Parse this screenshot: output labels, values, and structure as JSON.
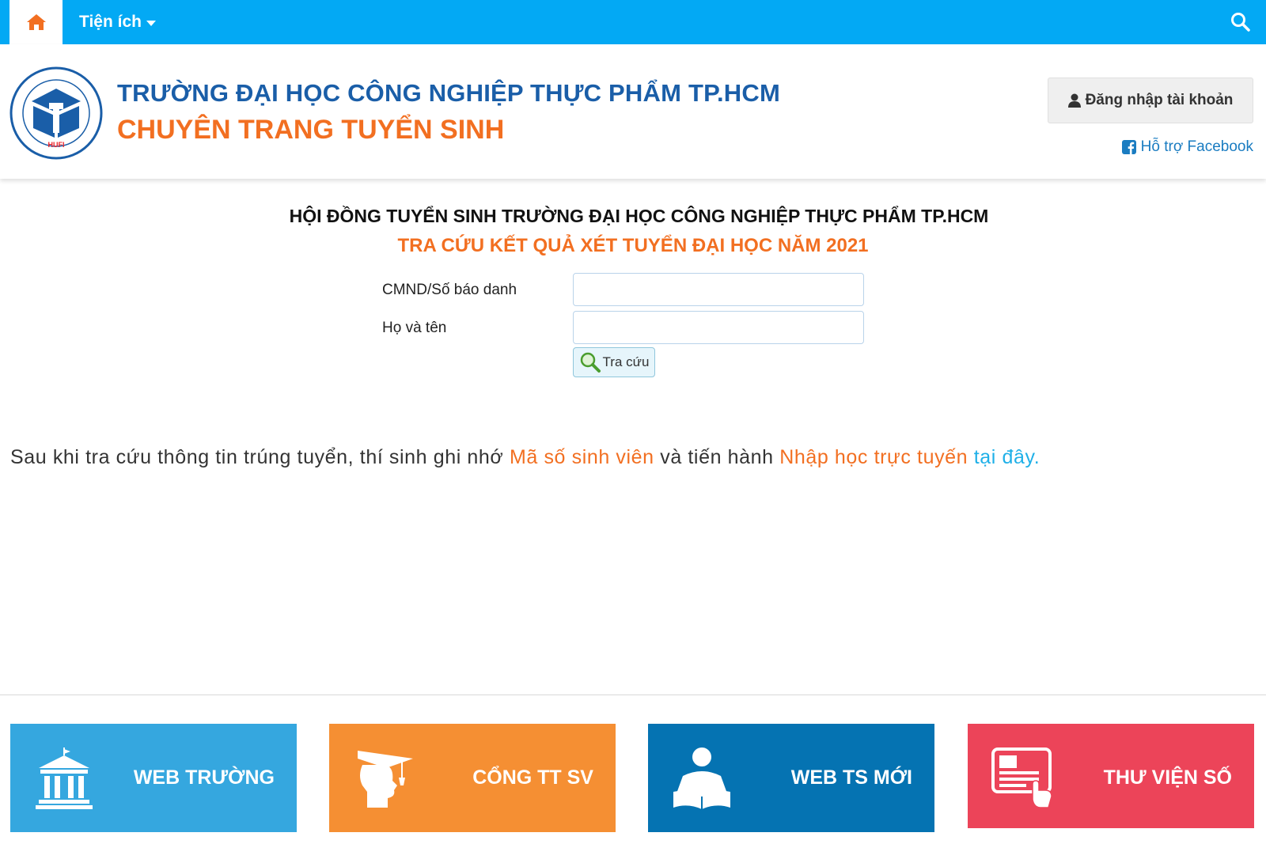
{
  "nav": {
    "home_icon": "home-icon",
    "utilities_label": "Tiện ích",
    "search_icon": "search-icon"
  },
  "header": {
    "school_name": "TRƯỜNG ĐẠI HỌC CÔNG NGHIỆP THỰC PHẨM TP.HCM",
    "section_name": "CHUYÊN TRANG TUYỂN SINH",
    "login_label": "Đăng nhập tài khoản",
    "facebook_support_label": "Hỗ trợ Facebook",
    "logo_text": "HUFI"
  },
  "main": {
    "council_title": "HỘI ĐỒNG TUYỂN SINH TRƯỜNG ĐẠI HỌC CÔNG NGHIỆP THỰC PHẨM TP.HCM",
    "lookup_title": "TRA CỨU KẾT QUẢ XÉT TUYỂN ĐẠI HỌC NĂM 2021",
    "id_label": "CMND/Số báo danh",
    "id_value": "",
    "name_label": "Họ và tên",
    "name_value": "",
    "search_button_label": "Tra cứu"
  },
  "notice": {
    "part1": "Sau khi tra cứu thông tin trúng tuyển, thí sinh ghi nhớ ",
    "student_id": "Mã số sinh viên",
    "part2": " và tiến hành ",
    "online_enrollment": "Nhập học trực tuyến",
    "link_text": " tại đây."
  },
  "tiles": [
    {
      "label": "WEB TRƯỜNG",
      "icon": "building-icon",
      "color": "#35a7df"
    },
    {
      "label": "CỔNG TT SV",
      "icon": "graduate-icon",
      "color": "#f58f33"
    },
    {
      "label": "WEB TS MỚI",
      "icon": "reader-icon",
      "color": "#0573b2"
    },
    {
      "label": "THƯ VIỆN SỐ",
      "icon": "digital-library-icon",
      "color": "#ec4459"
    }
  ],
  "colors": {
    "nav_bg": "#03a9f4",
    "accent_orange": "#f26f21",
    "school_blue": "#1a5ea8"
  }
}
